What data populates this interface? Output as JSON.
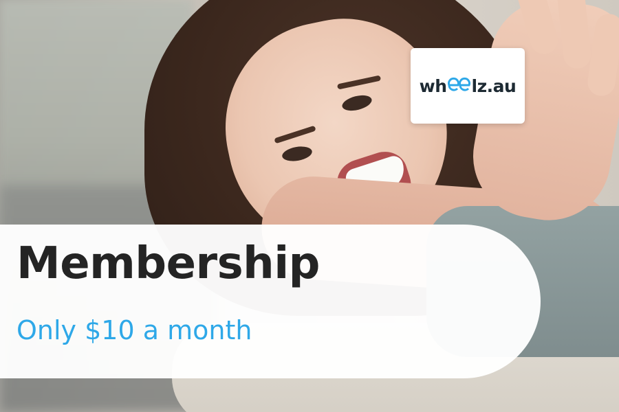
{
  "logo": {
    "prefix": "wh",
    "suffix": "lz.au",
    "accent_color": "#2ea8e8",
    "icon": "double-e-wheels-icon"
  },
  "banner": {
    "title": "Membership",
    "subtitle": "Only $10 a month"
  },
  "colors": {
    "title": "#242424",
    "subtitle": "#2ea8e8",
    "banner_bg": "#ffffff"
  }
}
